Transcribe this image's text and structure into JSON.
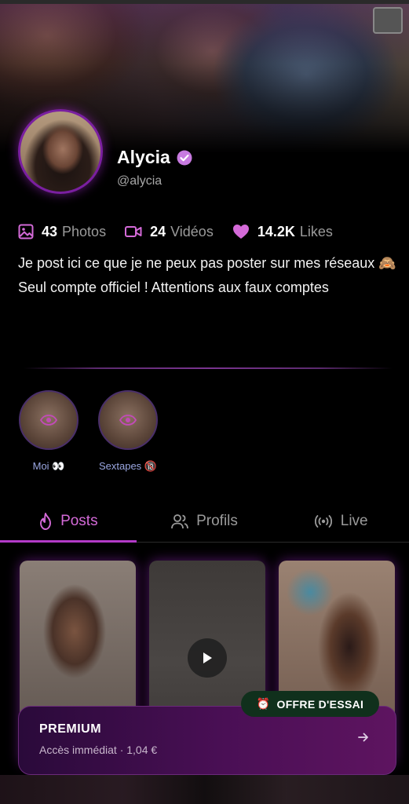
{
  "profile": {
    "name": "Alycia",
    "handle": "@alycia",
    "bio": "Je post ici ce que je ne peux pas poster sur mes réseaux 🙈 Seul compte officiel ! Attentions aux faux comptes"
  },
  "stats": {
    "photos": {
      "count": "43",
      "label": "Photos",
      "icon": "image-icon"
    },
    "videos": {
      "count": "24",
      "label": "Vidéos",
      "icon": "video-icon"
    },
    "likes": {
      "count": "14.2K",
      "label": "Likes",
      "icon": "heart-icon"
    }
  },
  "highlights": [
    {
      "label": "Moi 👀"
    },
    {
      "label": "Sextapes 🔞"
    }
  ],
  "tabs": [
    {
      "label": "Posts",
      "icon": "flame-icon",
      "active": true
    },
    {
      "label": "Profils",
      "icon": "users-icon",
      "active": false
    },
    {
      "label": "Live",
      "icon": "broadcast-icon",
      "active": false
    }
  ],
  "trial_badge": {
    "label": "OFFRE D'ESSAI",
    "icon": "alarm-clock-icon"
  },
  "premium": {
    "title": "PREMIUM",
    "subtitle": "Accès immédiat · 1,04 €"
  },
  "colors": {
    "accent": "#b33ac8",
    "accent_light": "#d46ad8",
    "verified": "#c77ae0",
    "trial_bg": "#10301c",
    "premium_bg": "#4a0f55"
  }
}
